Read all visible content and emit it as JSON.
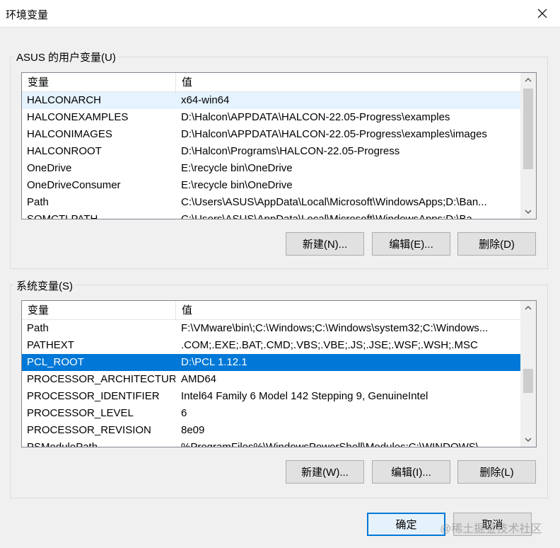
{
  "window": {
    "title": "环境变量",
    "close_icon": "close-icon"
  },
  "user_vars": {
    "group_label": "ASUS 的用户变量(U)",
    "columns": [
      "变量",
      "值"
    ],
    "rows": [
      {
        "name": "HALCONARCH",
        "value": "x64-win64"
      },
      {
        "name": "HALCONEXAMPLES",
        "value": "D:\\Halcon\\APPDATA\\HALCON-22.05-Progress\\examples"
      },
      {
        "name": "HALCONIMAGES",
        "value": "D:\\Halcon\\APPDATA\\HALCON-22.05-Progress\\examples\\images"
      },
      {
        "name": "HALCONROOT",
        "value": "D:\\Halcon\\Programs\\HALCON-22.05-Progress"
      },
      {
        "name": "OneDrive",
        "value": "E:\\recycle bin\\OneDrive"
      },
      {
        "name": "OneDriveConsumer",
        "value": "E:\\recycle bin\\OneDrive"
      },
      {
        "name": "Path",
        "value": "C:\\Users\\ASUS\\AppData\\Local\\Microsoft\\WindowsApps;D:\\Ban..."
      },
      {
        "name": "SOMCTLPATH",
        "value": "C:\\Users\\ASUS\\AppData\\Local\\Microsoft\\WindowsApps;D:\\Ba..."
      }
    ],
    "buttons": {
      "new": "新建(N)...",
      "edit": "编辑(E)...",
      "delete": "删除(D)"
    }
  },
  "sys_vars": {
    "group_label": "系统变量(S)",
    "columns": [
      "变量",
      "值"
    ],
    "rows": [
      {
        "name": "Path",
        "value": "F:\\VMware\\bin\\;C:\\Windows;C:\\Windows\\system32;C:\\Windows..."
      },
      {
        "name": "PATHEXT",
        "value": ".COM;.EXE;.BAT;.CMD;.VBS;.VBE;.JS;.JSE;.WSF;.WSH;.MSC"
      },
      {
        "name": "PCL_ROOT",
        "value": "D:\\PCL 1.12.1"
      },
      {
        "name": "PROCESSOR_ARCHITECTURE",
        "value": "AMD64"
      },
      {
        "name": "PROCESSOR_IDENTIFIER",
        "value": "Intel64 Family 6 Model 142 Stepping 9, GenuineIntel"
      },
      {
        "name": "PROCESSOR_LEVEL",
        "value": "6"
      },
      {
        "name": "PROCESSOR_REVISION",
        "value": "8e09"
      },
      {
        "name": "PSModulePath",
        "value": "%ProgramFiles%\\WindowsPowerShell\\Modules;C:\\WINDOWS\\..."
      }
    ],
    "buttons": {
      "new": "新建(W)...",
      "edit": "编辑(I)...",
      "delete": "删除(L)"
    }
  },
  "footer": {
    "ok": "确定",
    "cancel": "取消"
  },
  "watermark": "@稀土掘金技术社区",
  "colors": {
    "selection": "#0078d7",
    "hover": "#e5f3ff",
    "primary_border": "#0078d7"
  }
}
